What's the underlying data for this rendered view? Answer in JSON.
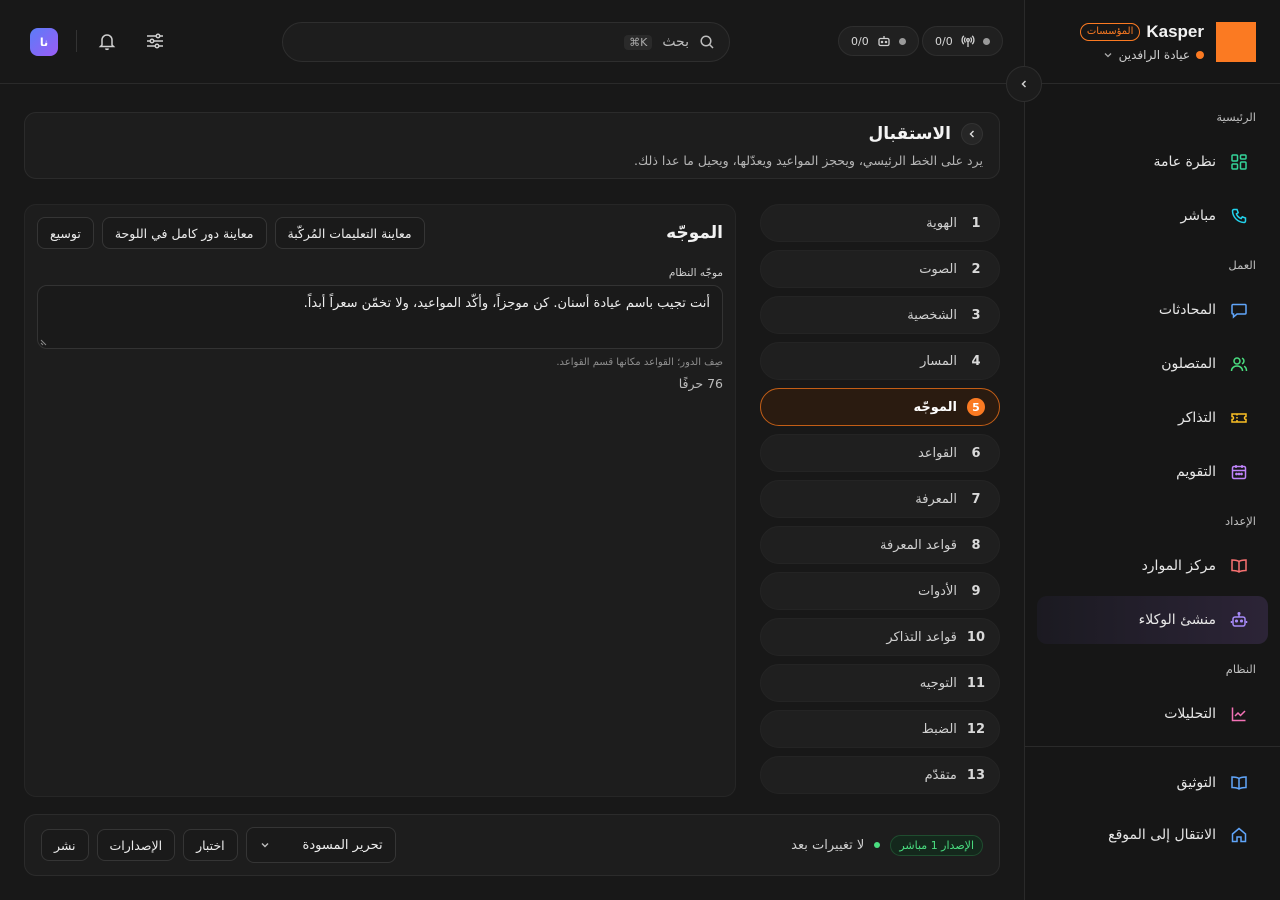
{
  "brand": {
    "name": "Kasper",
    "plan_badge": "المؤسسات",
    "org_name": "عيادة الرافدين"
  },
  "sidebar": {
    "sections": [
      {
        "label": "الرئيسية",
        "items": [
          {
            "label": "نظرة عامة",
            "icon": "grid-icon"
          },
          {
            "label": "مباشر",
            "icon": "phone-icon"
          }
        ]
      },
      {
        "label": "العمل",
        "items": [
          {
            "label": "المحادثات",
            "icon": "chat-icon"
          },
          {
            "label": "المتصلون",
            "icon": "users-icon"
          },
          {
            "label": "التذاكر",
            "icon": "ticket-icon"
          },
          {
            "label": "التقويم",
            "icon": "calendar-icon"
          }
        ]
      },
      {
        "label": "الإعداد",
        "items": [
          {
            "label": "مركز الموارد",
            "icon": "book-icon"
          },
          {
            "label": "منشئ الوكلاء",
            "icon": "bot-icon",
            "active": true
          }
        ]
      },
      {
        "label": "النظام",
        "items": [
          {
            "label": "التحليلات",
            "icon": "chart-icon"
          }
        ]
      }
    ],
    "footer": [
      {
        "label": "التوثيق",
        "icon": "docs-icon"
      },
      {
        "label": "الانتقال إلى الموقع",
        "icon": "home-icon"
      }
    ]
  },
  "topbar": {
    "pill_live": "0/0",
    "pill_agents": "0/0",
    "search_label": "بحث",
    "search_shortcut": "⌘K",
    "avatar_initials": "نا"
  },
  "page": {
    "title": "الاستقبال",
    "subtitle": "يرد على الخط الرئيسي، ويحجز المواعيد ويعدّلها، ويحيل ما عدا ذلك."
  },
  "steps": [
    {
      "num": "1",
      "label": "الهوية"
    },
    {
      "num": "2",
      "label": "الصوت"
    },
    {
      "num": "3",
      "label": "الشخصية"
    },
    {
      "num": "4",
      "label": "المسار"
    },
    {
      "num": "5",
      "label": "الموجّه",
      "active": true
    },
    {
      "num": "6",
      "label": "القواعد"
    },
    {
      "num": "7",
      "label": "المعرفة"
    },
    {
      "num": "8",
      "label": "قواعد المعرفة"
    },
    {
      "num": "9",
      "label": "الأدوات"
    },
    {
      "num": "10",
      "label": "قواعد التذاكر"
    },
    {
      "num": "11",
      "label": "التوجيه"
    },
    {
      "num": "12",
      "label": "الضبط"
    },
    {
      "num": "13",
      "label": "متقدّم"
    }
  ],
  "editor": {
    "title": "الموجّه",
    "btn_preview_compiled": "معاينة التعليمات المُركّبة",
    "btn_preview_full": "معاينة دور كامل في اللوحة",
    "btn_expand": "توسيع",
    "field_label": "موجّه النظام",
    "prompt_value": "أنت تجيب باسم عيادة أسنان. كن موجزاً، وأكّد المواعيد، ولا تخمّن سعراً أبداً.",
    "hint": "صِف الدور؛ القواعد مكانها قسم القواعد.",
    "char_count": "76 حرفًا"
  },
  "bottombar": {
    "version_badge": "الإصدار 1 مباشر",
    "status_text": "لا تغييرات بعد",
    "select_value": "تحرير المسودة",
    "btn_test": "اختبار",
    "btn_versions": "الإصدارات",
    "btn_publish": "نشر"
  },
  "colors": {
    "accent": "#fb7a22",
    "live_green": "#4ade80",
    "active_nav": "#2c2437"
  }
}
